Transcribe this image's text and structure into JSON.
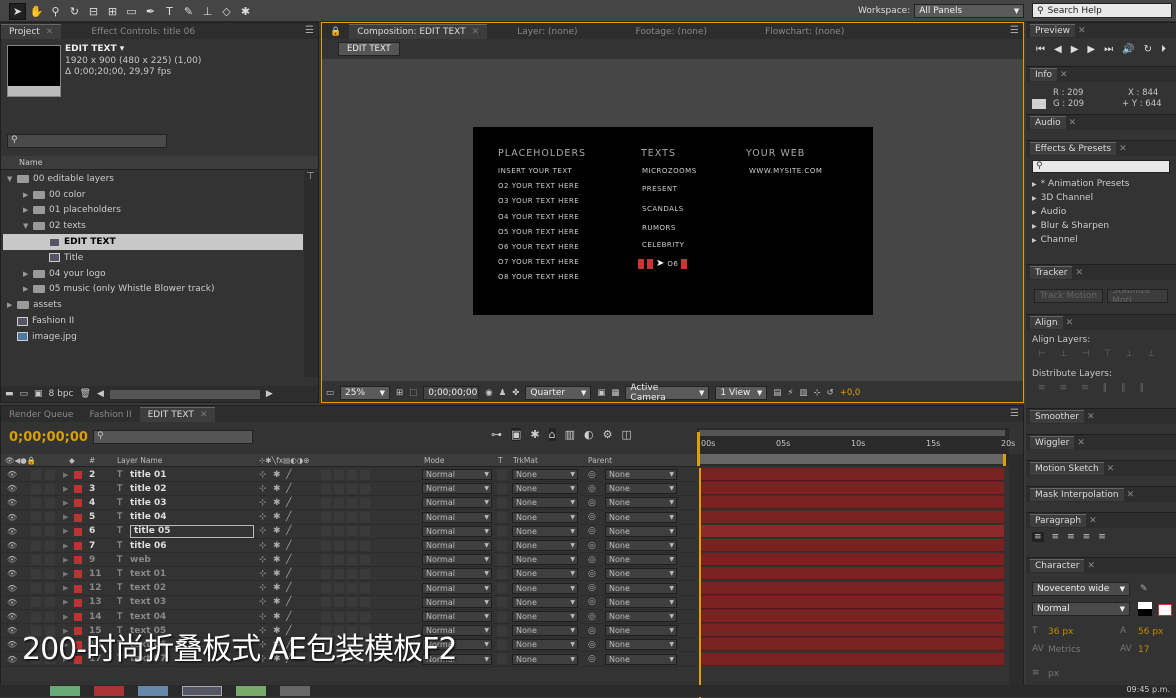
{
  "toolbar": {
    "workspace_label": "Workspace:",
    "workspace_value": "All Panels",
    "search_placeholder": "Search Help"
  },
  "project": {
    "tabs": [
      "Project",
      "Effect Controls: title 06"
    ],
    "comp_name": "EDIT TEXT ▾",
    "comp_info_1": "1920 x 900  (480 x 225) (1,00)",
    "comp_info_2": "Δ 0;00;20;00, 29,97 fps",
    "column_name": "Name",
    "items": [
      {
        "label": "00 editable layers",
        "indent": 0,
        "type": "folder",
        "open": true
      },
      {
        "label": "00 color",
        "indent": 1,
        "type": "folder"
      },
      {
        "label": "01 placeholders",
        "indent": 1,
        "type": "folder"
      },
      {
        "label": "02 texts",
        "indent": 1,
        "type": "folder",
        "open": true
      },
      {
        "label": "EDIT TEXT",
        "indent": 2,
        "type": "comp",
        "selected": true
      },
      {
        "label": "Title",
        "indent": 2,
        "type": "comp"
      },
      {
        "label": "04 your logo",
        "indent": 1,
        "type": "folder"
      },
      {
        "label": "05 music (only Whistle Blower track)",
        "indent": 1,
        "type": "folder"
      },
      {
        "label": "assets",
        "indent": 0,
        "type": "folder"
      },
      {
        "label": "Fashion II",
        "indent": 0,
        "type": "comp"
      },
      {
        "label": "image.jpg",
        "indent": 0,
        "type": "image"
      }
    ],
    "bpc": "8 bpc"
  },
  "viewer": {
    "tabs": [
      "Composition: EDIT TEXT",
      "Layer: (none)",
      "Footage: (none)",
      "Flowchart: (none)"
    ],
    "comp_button": "EDIT TEXT",
    "zoom": "25%",
    "timecode": "0;00;00;00",
    "resolution": "Quarter",
    "camera": "Active Camera",
    "view": "1 View",
    "exposure": "+0,0"
  },
  "comp_content": {
    "col1_head": "PLACEHOLDERS",
    "col1": [
      "INSERT YOUR TEXT",
      "O2 YOUR TEXT HERE",
      "O3 YOUR TEXT HERE",
      "O4 YOUR TEXT HERE",
      "O5 YOUR TEXT HERE",
      "O6 YOUR TEXT HERE",
      "O7 YOUR TEXT HERE",
      "O8 YOUR TEXT HERE"
    ],
    "col2_head": "TEXTS",
    "col2": [
      "MICROZOOMS",
      "PRESENT",
      "SCANDALS",
      "RUMORS",
      "CELEBRITY"
    ],
    "col2_last": "O6",
    "col3_head": "YOUR WEB",
    "col3": [
      "WWW.MYSITE.COM"
    ]
  },
  "right_panels": {
    "preview": "Preview",
    "info": "Info",
    "info_r": "R : 209",
    "info_g": "G : 209",
    "info_x": "X : 844",
    "info_y": "+ Y : 644",
    "audio": "Audio",
    "effects": "Effects & Presets",
    "effects_items": [
      "* Animation Presets",
      "3D Channel",
      "Audio",
      "Blur & Sharpen",
      "Channel"
    ],
    "tracker": "Tracker",
    "track_motion": "Track Motion",
    "stabilize": "Stabilize Moti",
    "align": "Align",
    "align_layers": "Align Layers:",
    "distribute_layers": "Distribute Layers:",
    "smoother": "Smoother",
    "wiggler": "Wiggler",
    "motion_sketch": "Motion Sketch",
    "mask_interp": "Mask Interpolation",
    "paragraph": "Paragraph",
    "character": "Character",
    "font": "Novecento wide",
    "font_style": "Normal",
    "font_size": "36 px",
    "leading": "56 px",
    "metrics": "Metrics",
    "tracking": "17",
    "px": "px"
  },
  "timeline": {
    "tabs": [
      "Render Queue",
      "Fashion II",
      "EDIT TEXT"
    ],
    "timecode": "0;00;00;00",
    "col_hash": "#",
    "col_layer": "Layer Name",
    "col_mode": "Mode",
    "col_t": "T",
    "col_trkmat": "TrkMat",
    "col_parent": "Parent",
    "ruler": [
      "00s",
      "05s",
      "10s",
      "15s",
      "20s"
    ],
    "layers": [
      {
        "num": "2",
        "name": "title 01"
      },
      {
        "num": "3",
        "name": "title 02"
      },
      {
        "num": "4",
        "name": "title 03"
      },
      {
        "num": "5",
        "name": "title 04"
      },
      {
        "num": "6",
        "name": "title 05",
        "selected": true
      },
      {
        "num": "7",
        "name": "title 06"
      },
      {
        "num": "9",
        "name": "web"
      },
      {
        "num": "11",
        "name": "text 01"
      },
      {
        "num": "12",
        "name": "text 02"
      },
      {
        "num": "13",
        "name": "text 03"
      },
      {
        "num": "14",
        "name": "text 04"
      },
      {
        "num": "15",
        "name": "text 05"
      },
      {
        "num": "16",
        "name": "text 06"
      },
      {
        "num": "17",
        "name": "text 07"
      }
    ],
    "mode_value": "Normal",
    "trkmat_value": "None",
    "parent_value": "None"
  },
  "watermark": "200-时尚折叠板式 AE包装模板F2",
  "clock": "09:45 p.m."
}
